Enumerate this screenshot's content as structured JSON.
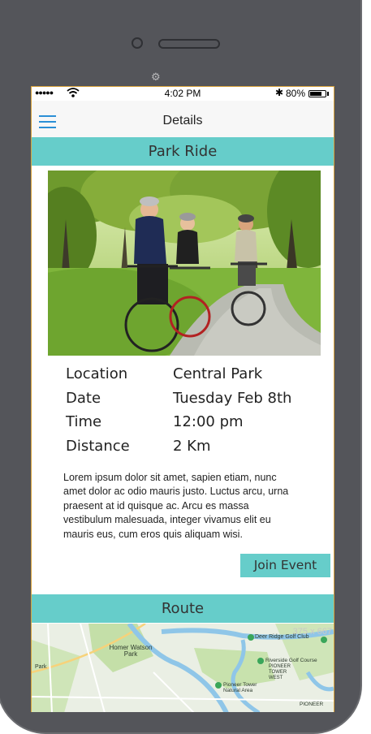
{
  "status": {
    "time": "4:02 PM",
    "battery": "80%",
    "battery_level": 0.8
  },
  "header": {
    "title": "Details"
  },
  "event": {
    "title": "Park Ride",
    "details": [
      {
        "label": "Location",
        "value": "Central Park"
      },
      {
        "label": "Date",
        "value": "Tuesday Feb 8th"
      },
      {
        "label": "Time",
        "value": "12:00 pm"
      },
      {
        "label": "Distance",
        "value": "2 Km"
      }
    ],
    "description": "Lorem ipsum dolor sit amet, sapien etiam, nunc amet dolor ac odio mauris justo. Luctus arcu, urna praesent at id quisque ac. Arcu es massa vestibulum malesuada, integer vivamus elit eu mauris eus, cum eros quis aliquam wisi.",
    "join_label": "Join Event"
  },
  "route": {
    "title": "Route",
    "map_size_label": "375 x 667",
    "labels": {
      "homer_watson": "Homer Watson Park",
      "deer_ridge": "Deer Ridge Golf Club",
      "riverside": "Riverside Golf Course",
      "pioneer_tower_west": "PIONEER TOWER WEST",
      "pioneer_tower_natural": "Pioneer Tower Natural Area",
      "park": "Park",
      "pioneer": "PIONEER"
    }
  },
  "colors": {
    "accent": "#66cdca",
    "menu_icon": "#2b8fd6",
    "phone_frame": "#54555a"
  }
}
